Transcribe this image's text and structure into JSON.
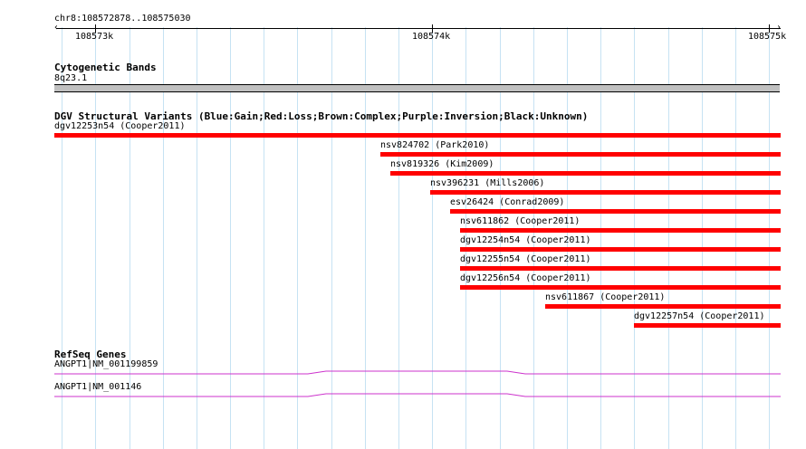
{
  "ruler": {
    "region": "chr8:108572878..108575030",
    "ticks": [
      "108573k",
      "108574k",
      "108575k"
    ]
  },
  "cytoband": {
    "title": "Cytogenetic Bands",
    "band_name": "8q23.1"
  },
  "dgv": {
    "title": "DGV Structural Variants (Blue:Gain;Red:Loss;Brown:Complex;Purple:Inversion;Black:Unknown)",
    "color": "#ff0000",
    "features": [
      "dgv12253n54 (Cooper2011)",
      "nsv824702 (Park2010)",
      "nsv819326 (Kim2009)",
      "nsv396231 (Mills2006)",
      "esv26424 (Conrad2009)",
      "nsv611862 (Cooper2011)",
      "dgv12254n54 (Cooper2011)",
      "dgv12255n54 (Cooper2011)",
      "dgv12256n54 (Cooper2011)",
      "nsv611867 (Cooper2011)",
      "dgv12257n54 (Cooper2011)"
    ]
  },
  "refseq": {
    "title": "RefSeq Genes",
    "color": "#cc33cc",
    "genes": [
      "ANGPT1|NM_001199859",
      "ANGPT1|NM_001146"
    ]
  }
}
